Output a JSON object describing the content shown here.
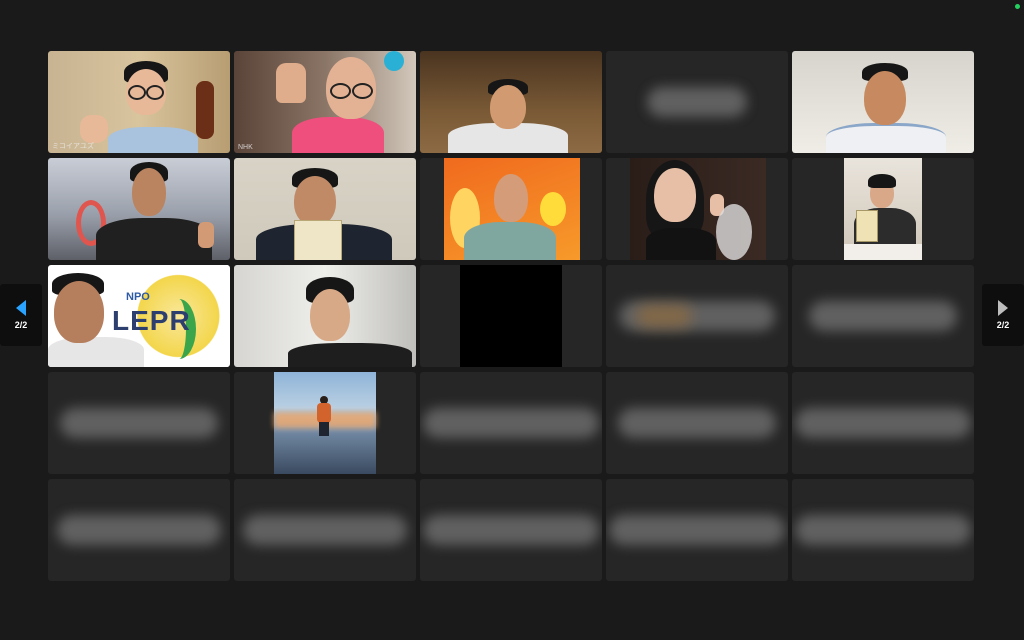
{
  "pagination": {
    "prev_label": "2/2",
    "next_label": "2/2"
  },
  "tiles": [
    {
      "label": "ミコイアユズ"
    },
    {
      "label": "NHK"
    },
    {
      "label": ""
    },
    {
      "label": ""
    },
    {
      "label": ""
    },
    {
      "label": ""
    },
    {
      "label": ""
    },
    {
      "label": ""
    },
    {
      "label": ""
    },
    {
      "label": ""
    },
    {
      "label": "NPO"
    },
    {
      "label": "LEPR"
    }
  ],
  "icons": {
    "prev": "triangle-left-icon",
    "next": "triangle-right-icon"
  },
  "colors": {
    "background": "#1a1a1a",
    "tile": "#262626",
    "active_arrow": "#29a3ff",
    "status": "#23d160"
  }
}
